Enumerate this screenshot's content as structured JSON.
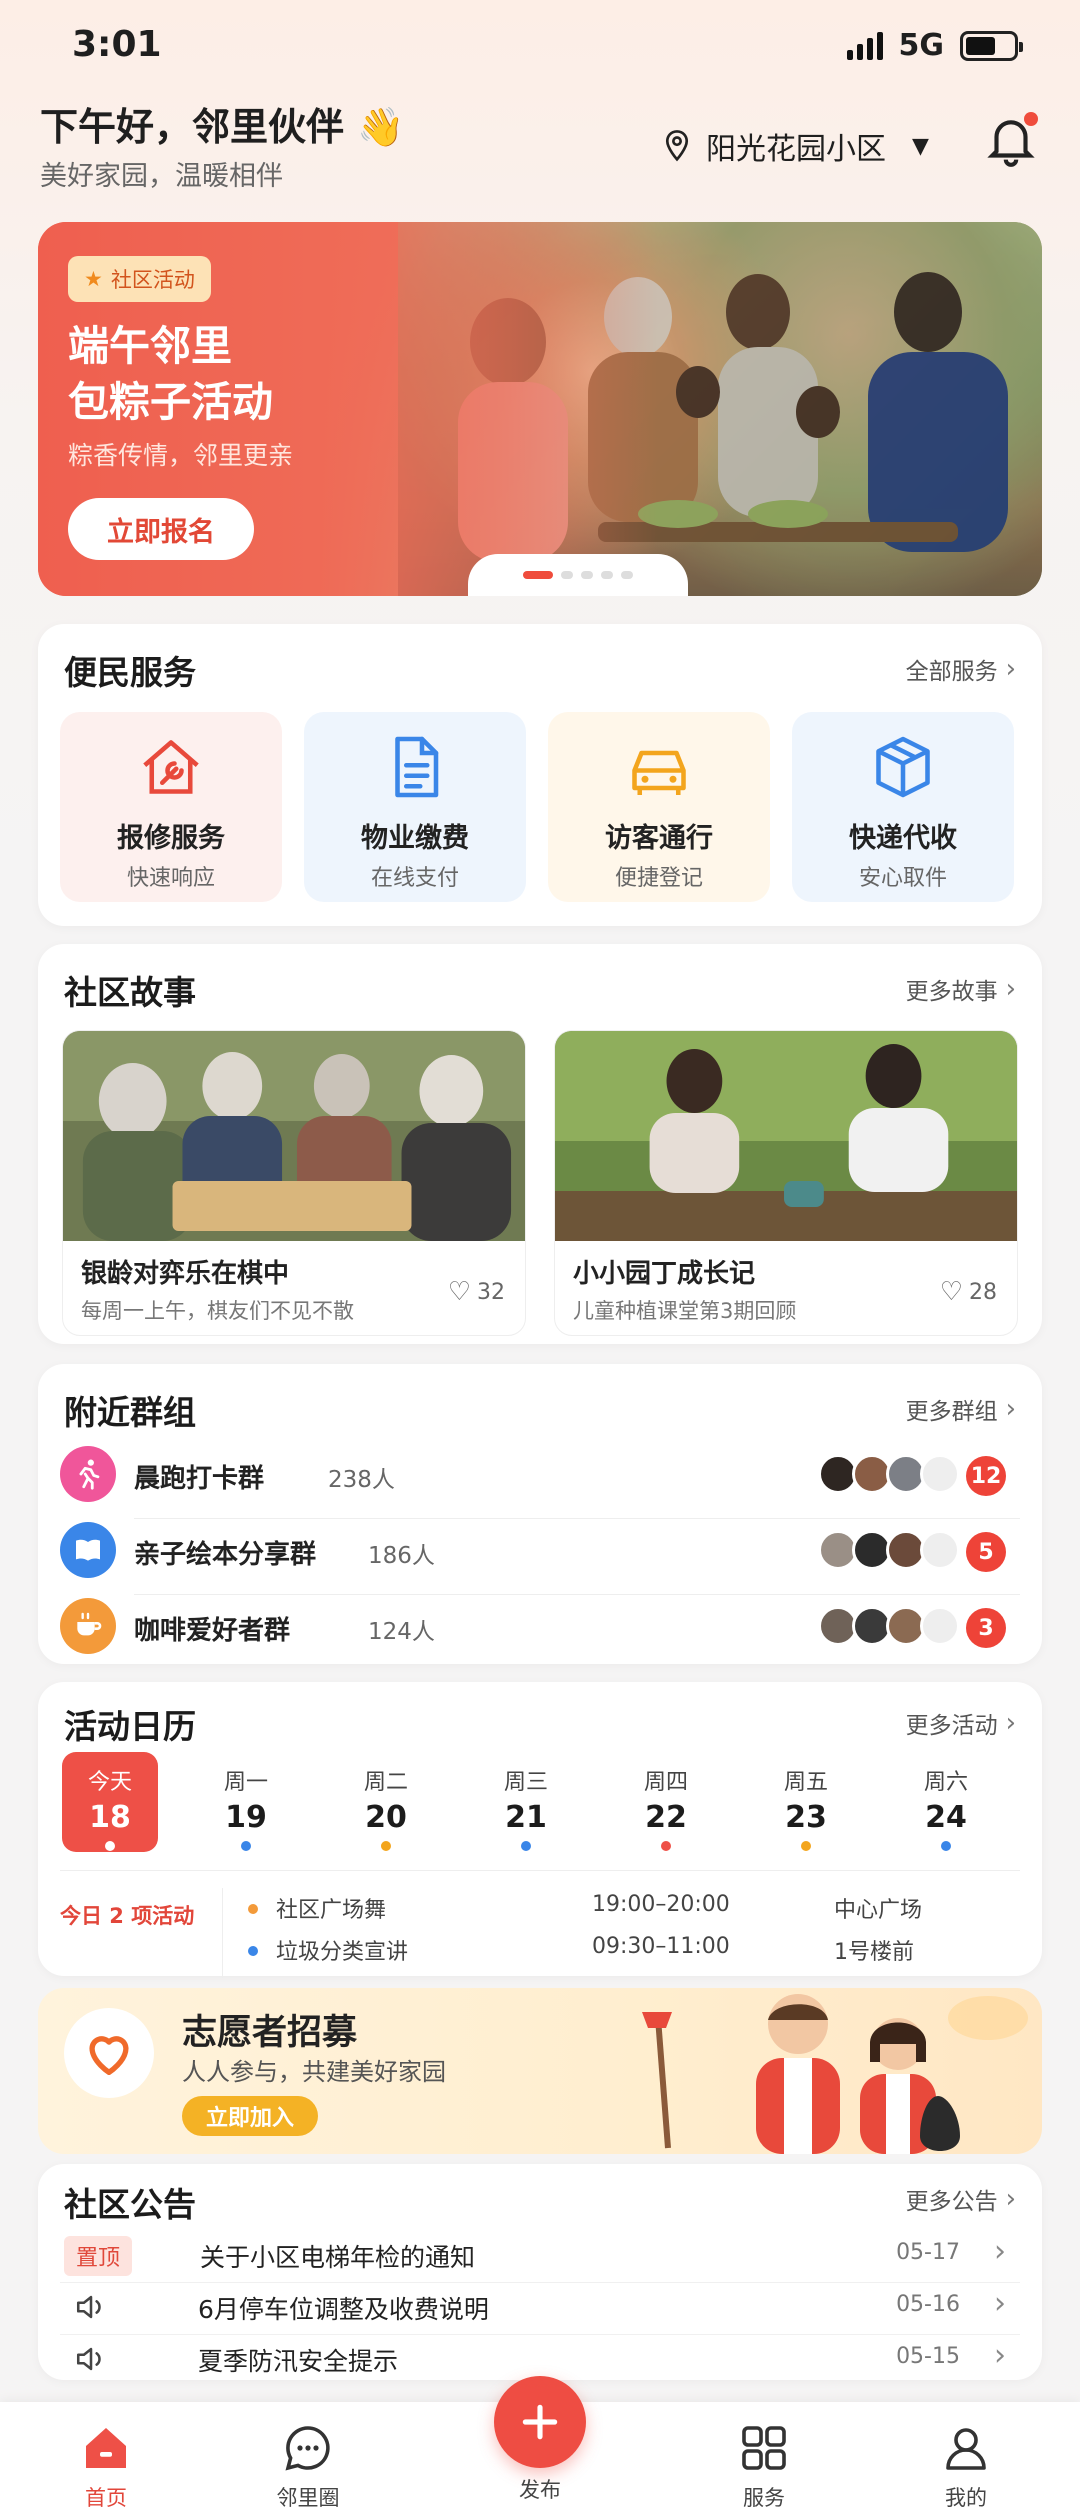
{
  "status": {
    "time": "3:01",
    "network": "5G"
  },
  "header": {
    "greeting": "下午好，邻里伙伴 👋",
    "subtitle": "美好家园，温暖相伴",
    "community": "阳光花园小区"
  },
  "banner": {
    "tag": "社区活动",
    "title_line1": "端午邻里",
    "title_line2": "包粽子活动",
    "subtitle": "粽香传情，邻里更亲",
    "button": "立即报名",
    "pages": 5,
    "active_page": 1
  },
  "services": {
    "title": "便民服务",
    "more": "全部服务",
    "items": [
      {
        "name": "报修服务",
        "desc": "快速响应",
        "icon": "house-wrench-icon",
        "color": "#e8493b",
        "bg": "#fdf0ee"
      },
      {
        "name": "物业缴费",
        "desc": "在线支付",
        "icon": "document-icon",
        "color": "#3a86e8",
        "bg": "#eef5fd"
      },
      {
        "name": "访客通行",
        "desc": "便捷登记",
        "icon": "car-icon",
        "color": "#f3a51d",
        "bg": "#fff7ea"
      },
      {
        "name": "快递代收",
        "desc": "安心取件",
        "icon": "package-icon",
        "color": "#3a86e8",
        "bg": "#eef5fd"
      }
    ]
  },
  "stories": {
    "title": "社区故事",
    "more": "更多故事",
    "items": [
      {
        "title": "银龄对弈乐在棋中",
        "desc": "每周一上午，棋友们不见不散",
        "likes": "32"
      },
      {
        "title": "小小园丁成长记",
        "desc": "儿童种植课堂第3期回顾",
        "likes": "28"
      }
    ]
  },
  "groups": {
    "title": "附近群组",
    "more": "更多群组",
    "items": [
      {
        "name": "晨跑打卡群",
        "count": "238人",
        "badge": "12",
        "icon": "runner-icon",
        "color": "#f0569a"
      },
      {
        "name": "亲子绘本分享群",
        "count": "186人",
        "badge": "5",
        "icon": "book-icon",
        "color": "#3a86e8"
      },
      {
        "name": "咖啡爱好者群",
        "count": "124人",
        "badge": "3",
        "icon": "coffee-icon",
        "color": "#f39a3a"
      }
    ]
  },
  "calendar": {
    "title": "活动日历",
    "more": "更多活动",
    "days": [
      {
        "week": "今天",
        "date": "18",
        "dot": "#ffffff"
      },
      {
        "week": "周一",
        "date": "19",
        "dot": "#3a86e8"
      },
      {
        "week": "周二",
        "date": "20",
        "dot": "#f3a51d"
      },
      {
        "week": "周三",
        "date": "21",
        "dot": "#3a86e8"
      },
      {
        "week": "周四",
        "date": "22",
        "dot": "#ee5047"
      },
      {
        "week": "周五",
        "date": "23",
        "dot": "#f3a51d"
      },
      {
        "week": "周六",
        "date": "24",
        "dot": "#3a86e8"
      }
    ],
    "today_label": "今日 2 项活动",
    "events": [
      {
        "name": "社区广场舞",
        "time": "19:00–20:00",
        "place": "中心广场",
        "color": "#f39a3a"
      },
      {
        "name": "垃圾分类宣讲",
        "time": "09:30–11:00",
        "place": "1号楼前",
        "color": "#3a86e8"
      }
    ]
  },
  "volunteer": {
    "title": "志愿者招募",
    "subtitle": "人人参与，共建美好家园",
    "button": "立即加入"
  },
  "notices": {
    "title": "社区公告",
    "more": "更多公告",
    "pin_label": "置顶",
    "items": [
      {
        "text": "关于小区电梯年检的通知",
        "date": "05-17",
        "pinned": true
      },
      {
        "text": "6月停车位调整及收费说明",
        "date": "05-16",
        "pinned": false
      },
      {
        "text": "夏季防汛安全提示",
        "date": "05-15",
        "pinned": false
      }
    ]
  },
  "tabbar": {
    "home": "首页",
    "neighbors": "邻里圈",
    "publish": "发布",
    "service": "服务",
    "mine": "我的"
  }
}
